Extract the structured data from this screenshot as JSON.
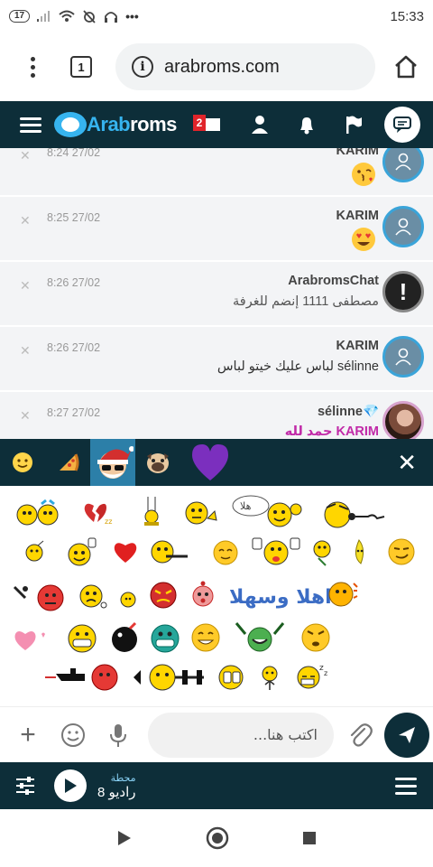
{
  "status": {
    "battery": "17",
    "time": "15:33",
    "icons": [
      "signal-icon",
      "wifi-icon",
      "muted-alarm-icon",
      "headphones-icon",
      "more-dots-icon"
    ]
  },
  "browser": {
    "tab_count": "1",
    "url": "arabroms.com"
  },
  "site": {
    "logo_part1": "Arab",
    "logo_part2": "roms",
    "mail_badge": "2"
  },
  "messages": [
    {
      "time": "8:24 27/02",
      "name": "KARIM",
      "text": "",
      "emoji": "kiss",
      "avatar": "default"
    },
    {
      "time": "8:25 27/02",
      "name": "KARIM",
      "text": "",
      "emoji": "heart-eyes",
      "avatar": "default"
    },
    {
      "time": "8:26 27/02",
      "name": "ArabromsChat",
      "text": "مصطفى 1111 إنضم للغرفة",
      "emoji": "",
      "avatar": "bot"
    },
    {
      "time": "8:26 27/02",
      "name": "KARIM",
      "text": "sélinne لباس عليك خيتو لباس",
      "emoji": "",
      "avatar": "default"
    },
    {
      "time": "8:27 27/02",
      "name": "sélinne",
      "text_prefix": "KARIM",
      "text": "حمد لله",
      "emoji": "",
      "avatar": "photo"
    }
  ],
  "emoji_panel": {
    "tabs": [
      "smiley-tab",
      "pizza-tab",
      "santa-tab",
      "pug-tab",
      "heart-tab"
    ],
    "active_tab": 2,
    "text_stickers": [
      "هلا",
      "اهلا وسهلا"
    ]
  },
  "composer": {
    "placeholder": "اكتب هنا..."
  },
  "radio": {
    "label": "محطة",
    "station": "راديو 8"
  },
  "colors": {
    "header_bg": "#0d2e39",
    "accent_blue": "#36b4ef",
    "active_tab": "#2c7fa8",
    "pink_name": "#c12aa8"
  }
}
